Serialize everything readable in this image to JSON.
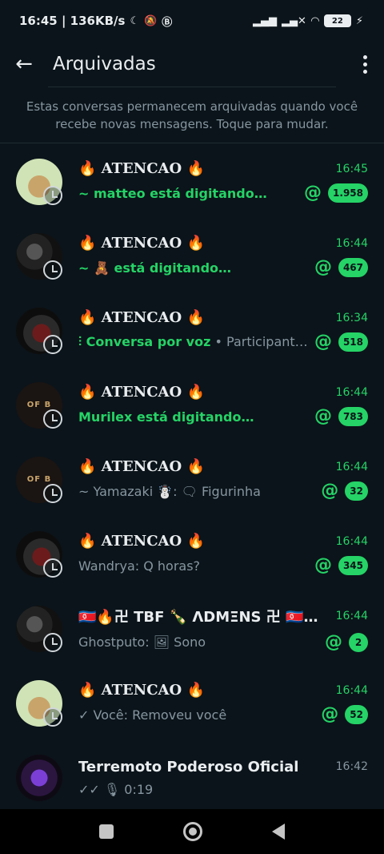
{
  "status_bar": {
    "time_speed": "16:45 | 136KB/s",
    "battery": "22"
  },
  "app_bar": {
    "title": "Arquivadas"
  },
  "info_text": "Estas conversas permanecem arquivadas quando você recebe novas mensagens. Toque para mudar.",
  "chats": [
    {
      "name": "🔥 ATENCAO 🔥",
      "time": "16:45",
      "preview": "~ matteo está digitando…",
      "typing": true,
      "mention": true,
      "count": "1.958"
    },
    {
      "name": "🔥 ATENCAO 🔥",
      "time": "16:44",
      "preview": "~ 🧸 está digitando…",
      "typing": true,
      "mention": true,
      "count": "467"
    },
    {
      "name": "🔥 ATENCAO 🔥",
      "time": "16:34",
      "preview_green": "Conversa por voz",
      "preview_rest": " • Participant…",
      "mention": true,
      "count": "518"
    },
    {
      "name": "🔥 ATENCAO 🔥",
      "time": "16:44",
      "preview": "Murilex está digitando…",
      "typing": true,
      "mention": true,
      "count": "783"
    },
    {
      "name": "🔥 ATENCAO 🔥",
      "time": "16:44",
      "preview": "~ Yamazaki ☃️: 🗨 Figurinha",
      "mention": true,
      "count": "32"
    },
    {
      "name": "🔥 ATENCAO 🔥",
      "time": "16:44",
      "preview": "Wandrya: Q horas?",
      "mention": true,
      "count": "345"
    },
    {
      "name": "🇰🇵🔥卍 TBF 🍾 ΛDMΞNS 卍 🇰🇵…",
      "time": "16:44",
      "preview": "Ghostputo: 🖼 Sono",
      "mention": true,
      "count": "2"
    },
    {
      "name": "🔥 ATENCAO 🔥",
      "time": "16:44",
      "preview": "✓ Você: Removeu você",
      "mention": true,
      "count": "52"
    },
    {
      "name": "Terremoto Poderoso Oficial",
      "time": "16:42",
      "preview": "✓✓ 🎙 0:19",
      "mention": false,
      "count": ""
    }
  ],
  "icons": {
    "back": "arrow-left",
    "menu": "more-vertical",
    "mention": "at-sign",
    "status": "clock-ring"
  },
  "colors": {
    "background": "#0b141a",
    "accent": "#25d366",
    "muted": "#8696a0"
  }
}
